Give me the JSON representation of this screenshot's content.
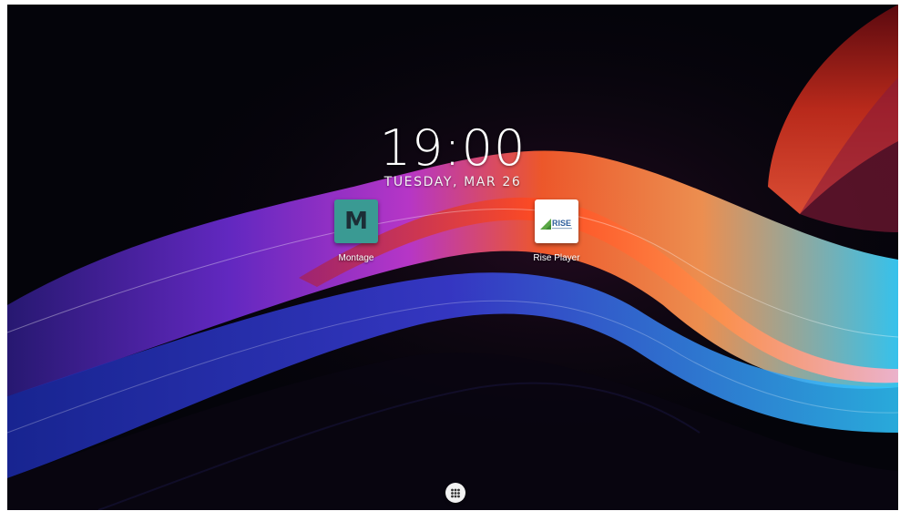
{
  "clock": {
    "time": "19:00",
    "date": "TUESDAY, MAR 26"
  },
  "apps": [
    {
      "label": "Montage",
      "icon_text": "M",
      "icon": "montage-app-icon",
      "icon_bg": "#3a9a93"
    },
    {
      "label": "Rise Player",
      "icon_text": "RISE",
      "icon": "rise-player-app-icon",
      "icon_bg": "#ffffff"
    }
  ],
  "dock": {
    "app_drawer_icon": "grid-dots-icon"
  },
  "colors": {
    "wallpaper_base": "#04040a",
    "wave_purple": "#7b2fd6",
    "wave_orange": "#ff6a2a",
    "wave_cyan": "#39d0ff",
    "wave_red": "#c8221e"
  }
}
